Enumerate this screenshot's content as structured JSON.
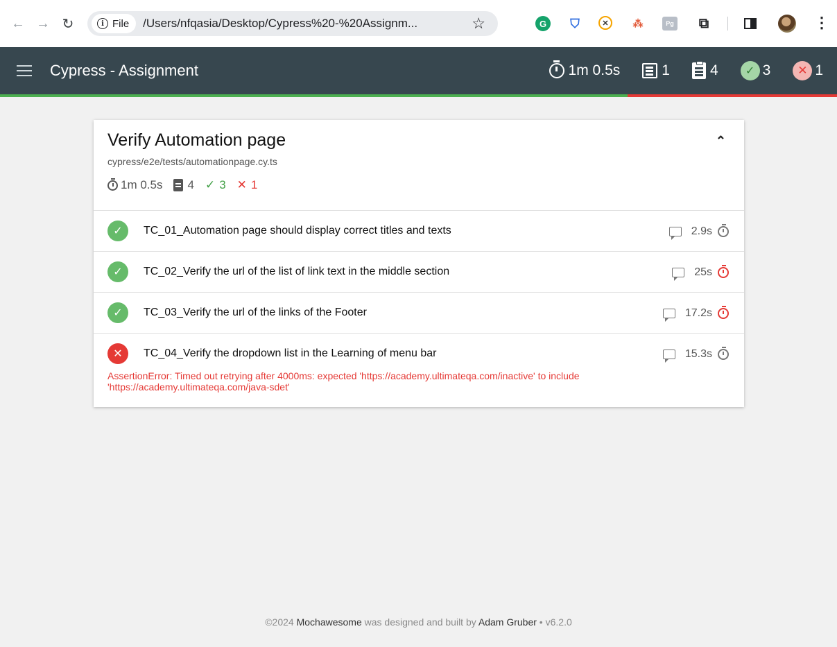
{
  "browser": {
    "file_chip": "File",
    "url": "/Users/nfqasia/Desktop/Cypress%20-%20Assignm..."
  },
  "navbar": {
    "title": "Cypress - Assignment",
    "duration": "1m 0.5s",
    "suites": "1",
    "tests": "4",
    "passes": "3",
    "failures": "1"
  },
  "progress": {
    "pass_fraction": 0.75
  },
  "suite": {
    "title": "Verify Automation page",
    "file": "cypress/e2e/tests/automationpage.cy.ts",
    "duration": "1m 0.5s",
    "tests": "4",
    "passes": "3",
    "failures": "1",
    "items": [
      {
        "title": "TC_01_Automation page should display correct titles and texts",
        "duration": "2.9s",
        "state": "passed",
        "speed": "normal"
      },
      {
        "title": "TC_02_Verify the url of the list of link text in the middle section",
        "duration": "25s",
        "state": "passed",
        "speed": "slow"
      },
      {
        "title": "TC_03_Verify the url of the links of the Footer",
        "duration": "17.2s",
        "state": "passed",
        "speed": "slow"
      },
      {
        "title": "TC_04_Verify the dropdown list in the Learning of menu bar",
        "duration": "15.3s",
        "state": "failed",
        "speed": "normal",
        "error": "AssertionError: Timed out retrying after 4000ms: expected 'https://academy.ultimateqa.com/inactive' to include 'https://academy.ultimateqa.com/java-sdet'"
      }
    ]
  },
  "footer": {
    "prefix": "©2024 ",
    "brand": "Mochawesome",
    "middle": " was designed and built by ",
    "author": "Adam Gruber",
    "version": " • v6.2.0"
  },
  "colors": {
    "navbar": "#37474f",
    "pass": "#4caf50",
    "fail": "#e53935"
  }
}
